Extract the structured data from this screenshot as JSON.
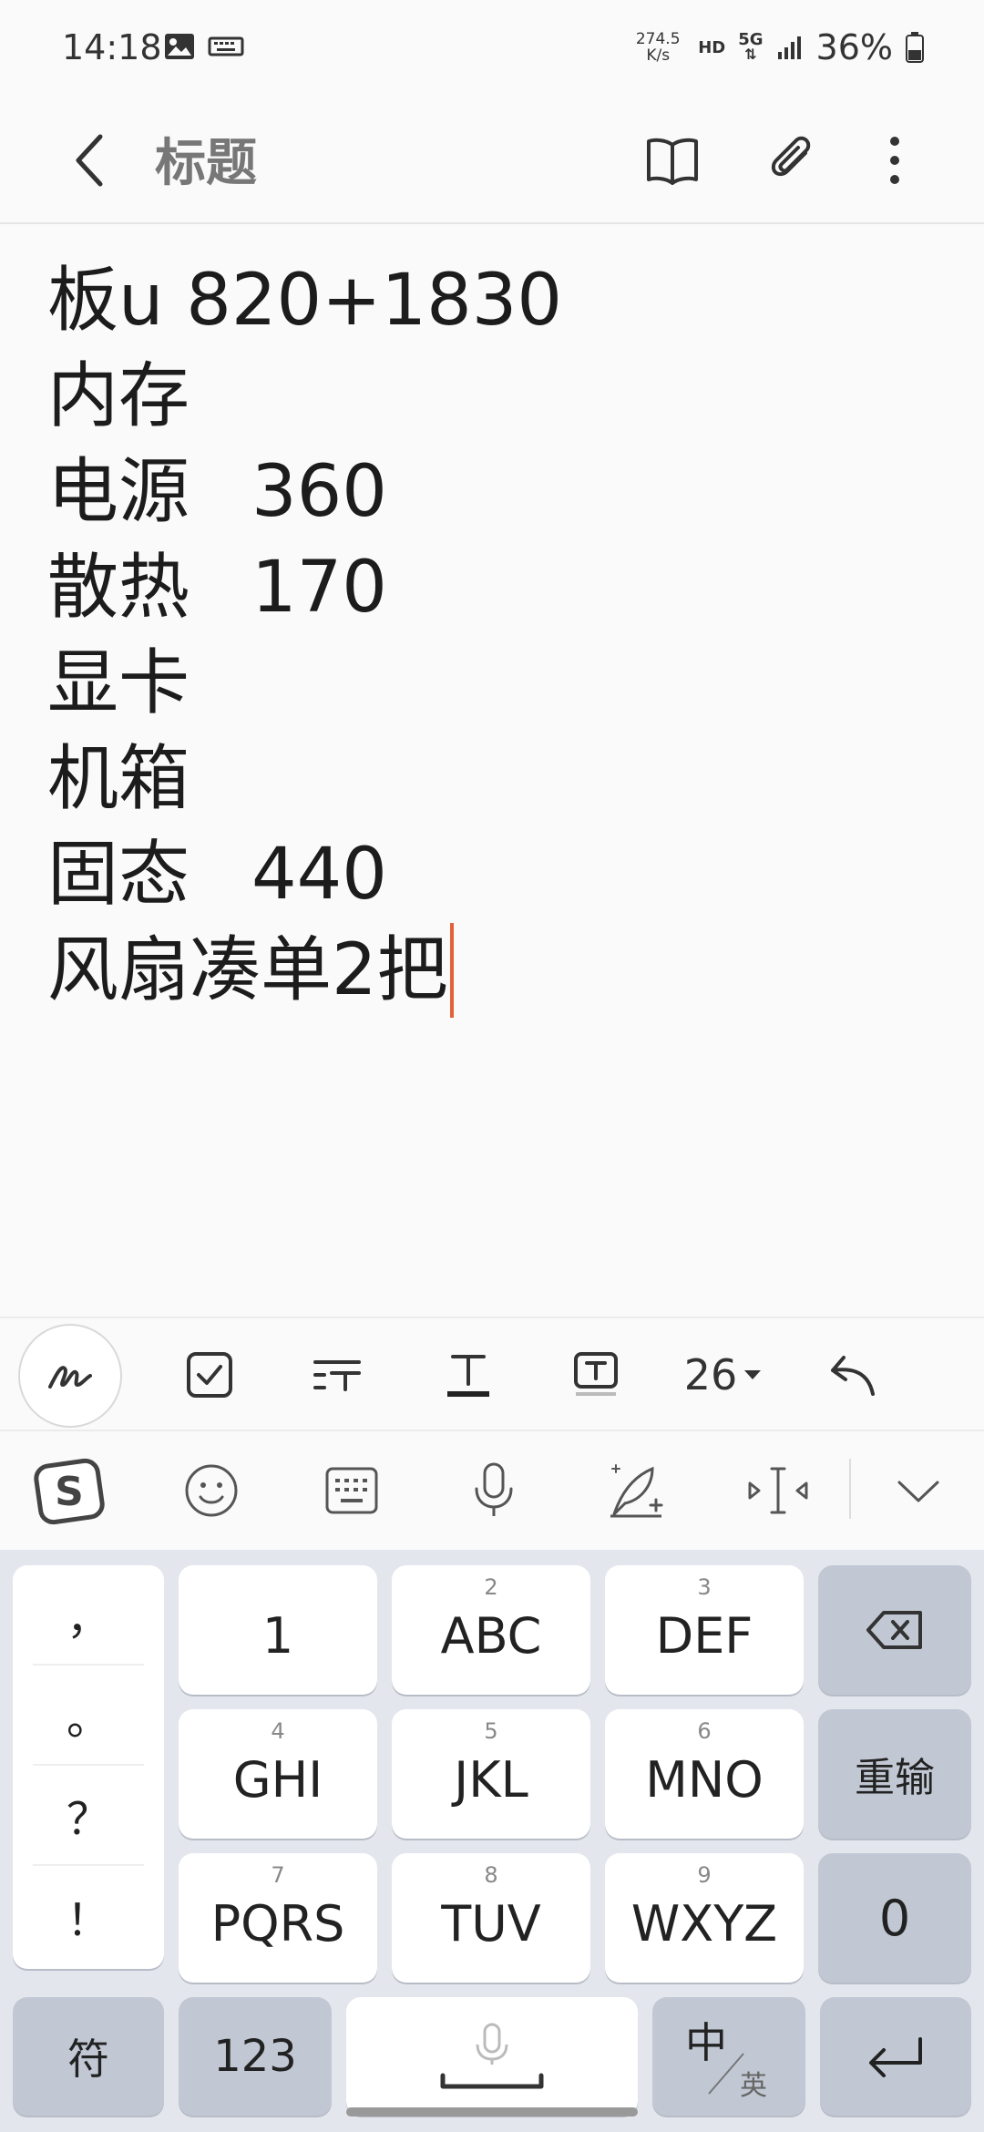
{
  "status_bar": {
    "time": "14:18",
    "speed_value": "274.5",
    "speed_unit": "K/s",
    "hd": "HD",
    "network": "5G",
    "battery": "36%"
  },
  "header": {
    "title": "标题"
  },
  "note": {
    "lines": [
      {
        "label": "板u",
        "value": "820+1830",
        "inline": true
      },
      {
        "label": "内存",
        "value": ""
      },
      {
        "label": "电源",
        "value": "360"
      },
      {
        "label": "散热",
        "value": "170"
      },
      {
        "label": "显卡",
        "value": ""
      },
      {
        "label": "机箱",
        "value": ""
      },
      {
        "label": "固态",
        "value": "440"
      },
      {
        "label": "风扇凑单2把",
        "value": ""
      }
    ]
  },
  "toolbar": {
    "font_size": "26"
  },
  "keyboard": {
    "punct": [
      "，",
      "。",
      "？",
      "！"
    ],
    "keys": [
      {
        "sub": "",
        "main": "1"
      },
      {
        "sub": "2",
        "main": "ABC"
      },
      {
        "sub": "3",
        "main": "DEF"
      },
      {
        "sub": "4",
        "main": "GHI"
      },
      {
        "sub": "5",
        "main": "JKL"
      },
      {
        "sub": "6",
        "main": "MNO"
      },
      {
        "sub": "7",
        "main": "PQRS"
      },
      {
        "sub": "8",
        "main": "TUV"
      },
      {
        "sub": "9",
        "main": "WXYZ"
      }
    ],
    "reinput": "重输",
    "zero": "0",
    "symbols": "符",
    "numbers": "123",
    "lang_main": "中",
    "lang_sub": "英"
  },
  "colors": {
    "cursor": "#e3603a",
    "keyboard_bg": "#e3e6ed",
    "dark_key": "#c2c8d3"
  }
}
